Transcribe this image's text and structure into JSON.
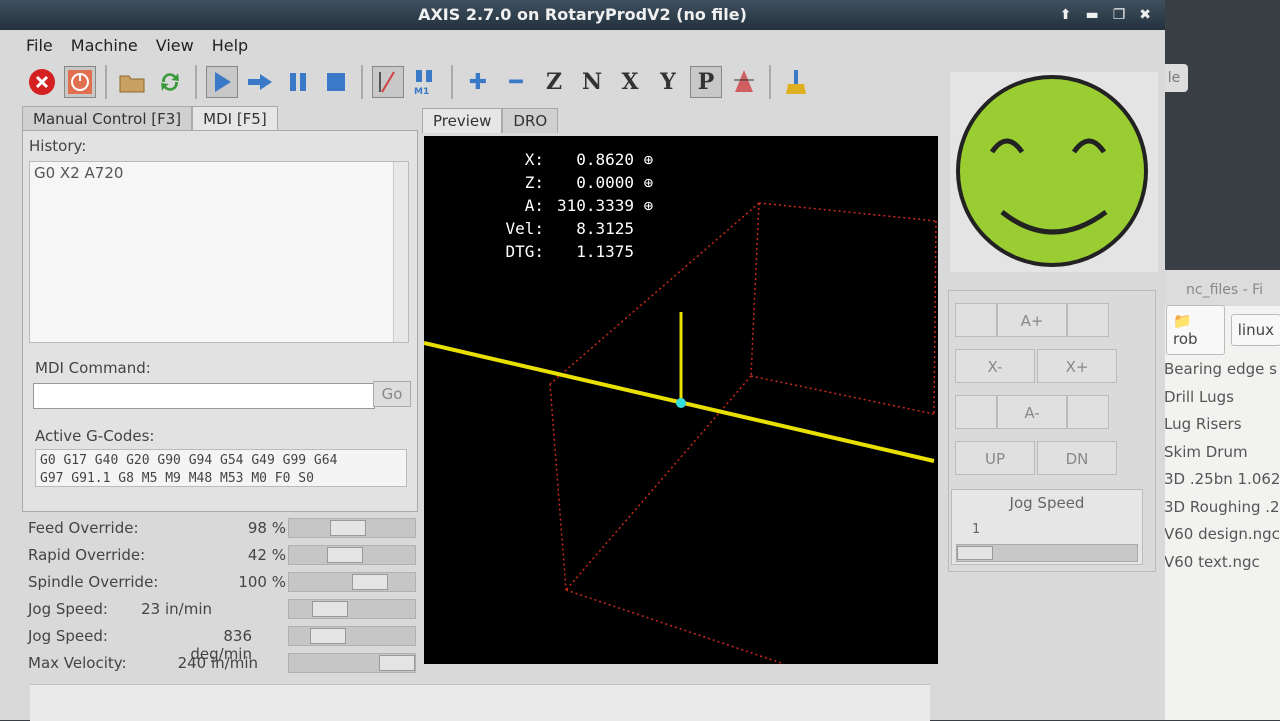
{
  "window": {
    "title": "AXIS 2.7.0 on RotaryProdV2 (no file)"
  },
  "menu": [
    "File",
    "Machine",
    "View",
    "Help"
  ],
  "left_tabs": {
    "manual": "Manual Control [F3]",
    "mdi": "MDI [F5]"
  },
  "mdi": {
    "history_label": "History:",
    "history": [
      "G0 X2 A720"
    ],
    "command_label": "MDI Command:",
    "command_value": "",
    "go_label": "Go",
    "active_label": "Active G-Codes:",
    "active_line1": "G0 G17 G40 G20 G90 G94 G54 G49 G99 G64",
    "active_line2": "G97 G91.1 G8 M5 M9 M48 M53 M0 F0 S0"
  },
  "overrides": [
    {
      "name": "Feed Override:",
      "value": "98 %",
      "level": 0.45
    },
    {
      "name": "Rapid Override:",
      "value": "42 %",
      "level": 0.42
    },
    {
      "name": "Spindle Override:",
      "value": "100 %",
      "level": 0.7
    },
    {
      "name": "Jog Speed:",
      "value": "23 in/min",
      "level": 0.25
    },
    {
      "name": "Jog Speed:",
      "value": "836 deg/min",
      "level": 0.23
    },
    {
      "name": "Max Velocity:",
      "value": "240 in/min",
      "level": 1.0
    }
  ],
  "preview_tabs": {
    "preview": "Preview",
    "dro": "DRO"
  },
  "dro": [
    {
      "axis": "X:",
      "value": "0.8620"
    },
    {
      "axis": "Z:",
      "value": "0.0000"
    },
    {
      "axis": "A:",
      "value": "310.3339"
    },
    {
      "axis": "Vel:",
      "value": "8.3125"
    },
    {
      "axis": "DTG:",
      "value": "1.1375"
    }
  ],
  "jog": {
    "a_plus": "A+",
    "x_minus": "X-",
    "x_plus": "X+",
    "a_minus": "A-",
    "up": "UP",
    "dn": "DN",
    "speed_label": "Jog Speed",
    "speed_value": "1"
  },
  "background_window": {
    "title": "nc_files - Fi",
    "crumbs": [
      "rob",
      "linux"
    ],
    "files": [
      "Bearing edge s",
      "Drill Lugs",
      "Lug Risers",
      "Skim Drum",
      "3D .25bn 1.062",
      "3D Roughing .2",
      "V60 design.ngc",
      "V60 text.ngc"
    ],
    "tab_label": "le"
  },
  "colors": {
    "smiley": "#9acd32",
    "toolpath": "#e8e000",
    "bounds": "#cc2a1e",
    "tool": "#33dddd"
  }
}
